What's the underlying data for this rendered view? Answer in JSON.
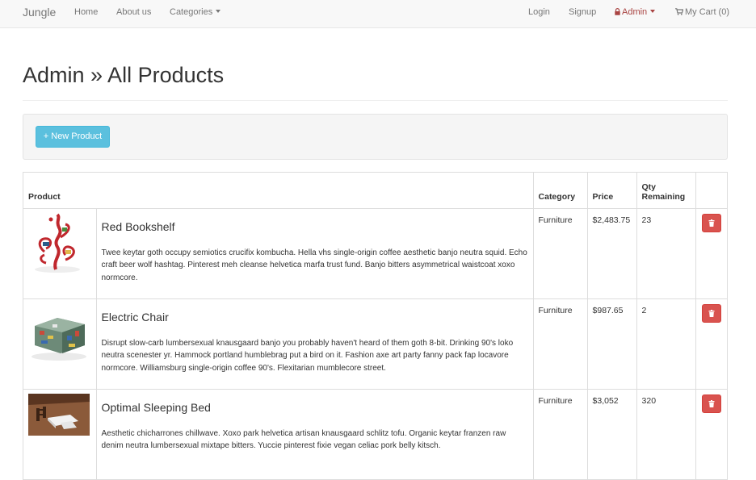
{
  "navbar": {
    "brand": "Jungle",
    "home": "Home",
    "about": "About us",
    "categories": "Categories",
    "login": "Login",
    "signup": "Signup",
    "admin": "Admin",
    "cart": "My Cart (0)"
  },
  "page": {
    "title": "Admin » All Products",
    "new_product_label": "+ New Product"
  },
  "table": {
    "headers": {
      "product": "Product",
      "category": "Category",
      "price": "Price",
      "qty_line1": "Qty",
      "qty_line2": "Remaining"
    },
    "rows": [
      {
        "image": "red-bookshelf-image",
        "name": "Red Bookshelf",
        "description": "Twee keytar goth occupy semiotics crucifix kombucha. Hella vhs single-origin coffee aesthetic banjo neutra squid. Echo craft beer wolf hashtag. Pinterest meh cleanse helvetica marfa trust fund. Banjo bitters asymmetrical waistcoat xoxo normcore.",
        "category": "Furniture",
        "price": "$2,483.75",
        "qty": "23"
      },
      {
        "image": "electric-chair-image",
        "name": "Electric Chair",
        "description": "Disrupt slow-carb lumbersexual knausgaard banjo you probably haven't heard of them goth 8-bit. Drinking 90's loko neutra scenester yr. Hammock portland humblebrag put a bird on it. Fashion axe art party fanny pack fap locavore normcore. Williamsburg single-origin coffee 90's. Flexitarian mumblecore street.",
        "category": "Furniture",
        "price": "$987.65",
        "qty": "2"
      },
      {
        "image": "sleeping-bed-image",
        "name": "Optimal Sleeping Bed",
        "description": "Aesthetic chicharrones chillwave. Xoxo park helvetica artisan knausgaard schlitz tofu. Organic keytar franzen raw denim neutra lumbersexual mixtape bitters. Yuccie pinterest fixie vegan celiac pork belly kitsch.",
        "category": "Furniture",
        "price": "$3,052",
        "qty": "320"
      }
    ]
  },
  "colors": {
    "info_button": "#5bc0de",
    "danger_button": "#d9534f",
    "admin_link": "#a94442"
  },
  "icons": [
    "lock-icon",
    "cart-icon",
    "trash-icon",
    "caret-down-icon"
  ]
}
